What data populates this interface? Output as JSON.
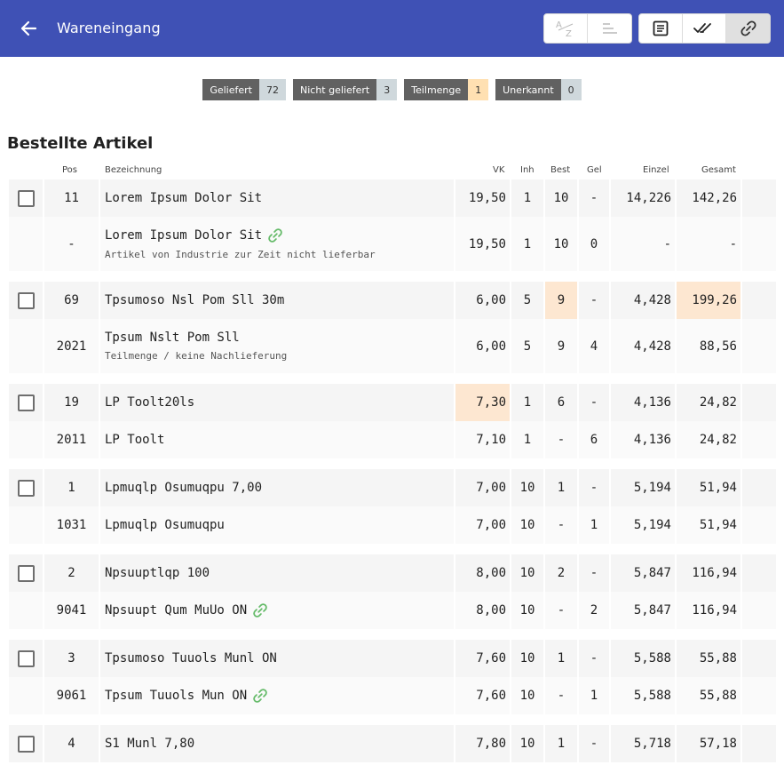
{
  "header": {
    "title": "Wareneingang",
    "sort_az_icon": "sort-alpha-icon",
    "sort_lines_icon": "sort-lines-icon",
    "toggles": [
      "list-icon",
      "double-check-icon",
      "link-icon"
    ],
    "active_toggle": "link-icon",
    "color": "#3f51b5"
  },
  "chips": [
    {
      "label": "Geliefert",
      "count": "72",
      "accent": "#cfd8dc"
    },
    {
      "label": "Nicht geliefert",
      "count": "3",
      "accent": "#cfd8dc"
    },
    {
      "label": "Teilmenge",
      "count": "1",
      "accent": "#ffe0b2"
    },
    {
      "label": "Unerkannt",
      "count": "0",
      "accent": "#cfd8dc"
    }
  ],
  "section": {
    "title": "Bestellte Artikel"
  },
  "columns": {
    "pos": "Pos",
    "bez": "Bezeichnung",
    "vk": "VK",
    "inh": "Inh",
    "best": "Best",
    "gel": "Gel",
    "einzel": "Einzel",
    "gesamt": "Gesamt"
  },
  "groups": [
    {
      "main": {
        "pos": "11",
        "bez": "Lorem Ipsum Dolor Sit",
        "vk": "19,50",
        "inh": "1",
        "best": "10",
        "gel": "-",
        "einzel": "14,226",
        "gesamt": "142,26"
      },
      "sub": {
        "pos": "-",
        "bez": "Lorem Ipsum Dolor Sit",
        "note": "Artikel von Industrie zur Zeit nicht lieferbar",
        "vk": "19,50",
        "inh": "1",
        "best": "10",
        "gel": "0",
        "einzel": "-",
        "gesamt": "-"
      }
    },
    {
      "main": {
        "pos": "69",
        "bez": "Tpsumoso Nsl Pom Sll 30m",
        "vk": "6,00",
        "inh": "5",
        "best": "9",
        "gel": "-",
        "einzel": "4,428",
        "gesamt": "199,26"
      },
      "sub": {
        "pos": "2021",
        "bez": "Tpsum Nslt Pom Sll",
        "note": "Teilmenge / keine Nachlieferung",
        "vk": "6,00",
        "inh": "5",
        "best": "9",
        "gel": "4",
        "einzel": "4,428",
        "gesamt": "88,56"
      }
    },
    {
      "main": {
        "pos": "19",
        "bez": "LP Toolt20ls",
        "vk": "7,30",
        "inh": "1",
        "best": "6",
        "gel": "-",
        "einzel": "4,136",
        "gesamt": "24,82"
      },
      "sub": {
        "pos": "2011",
        "bez": "LP Toolt",
        "vk": "7,10",
        "inh": "1",
        "best": "-",
        "gel": "6",
        "einzel": "4,136",
        "gesamt": "24,82"
      }
    },
    {
      "main": {
        "pos": "1",
        "bez": "Lpmuqlp Osumuqpu 7,00",
        "vk": "7,00",
        "inh": "10",
        "best": "1",
        "gel": "-",
        "einzel": "5,194",
        "gesamt": "51,94"
      },
      "sub": {
        "pos": "1031",
        "bez": "Lpmuqlp Osumuqpu",
        "vk": "7,00",
        "inh": "10",
        "best": "-",
        "gel": "1",
        "einzel": "5,194",
        "gesamt": "51,94"
      }
    },
    {
      "main": {
        "pos": "2",
        "bez": "Npsuuptlqp 100",
        "vk": "8,00",
        "inh": "10",
        "best": "2",
        "gel": "-",
        "einzel": "5,847",
        "gesamt": "116,94"
      },
      "sub": {
        "pos": "9041",
        "bez": "Npsuupt Qum MuUo ON",
        "vk": "8,00",
        "inh": "10",
        "best": "-",
        "gel": "2",
        "einzel": "5,847",
        "gesamt": "116,94"
      }
    },
    {
      "main": {
        "pos": "3",
        "bez": "Tpsumoso Tuuols Munl ON",
        "vk": "7,60",
        "inh": "10",
        "best": "1",
        "gel": "-",
        "einzel": "5,588",
        "gesamt": "55,88"
      },
      "sub": {
        "pos": "9061",
        "bez": "Tpsum Tuuols Mun ON",
        "vk": "7,60",
        "inh": "10",
        "best": "-",
        "gel": "1",
        "einzel": "5,588",
        "gesamt": "55,88"
      }
    },
    {
      "main": {
        "pos": "4",
        "bez": "S1 Munl 7,80",
        "vk": "7,80",
        "inh": "10",
        "best": "1",
        "gel": "-",
        "einzel": "5,718",
        "gesamt": "57,18"
      }
    }
  ]
}
